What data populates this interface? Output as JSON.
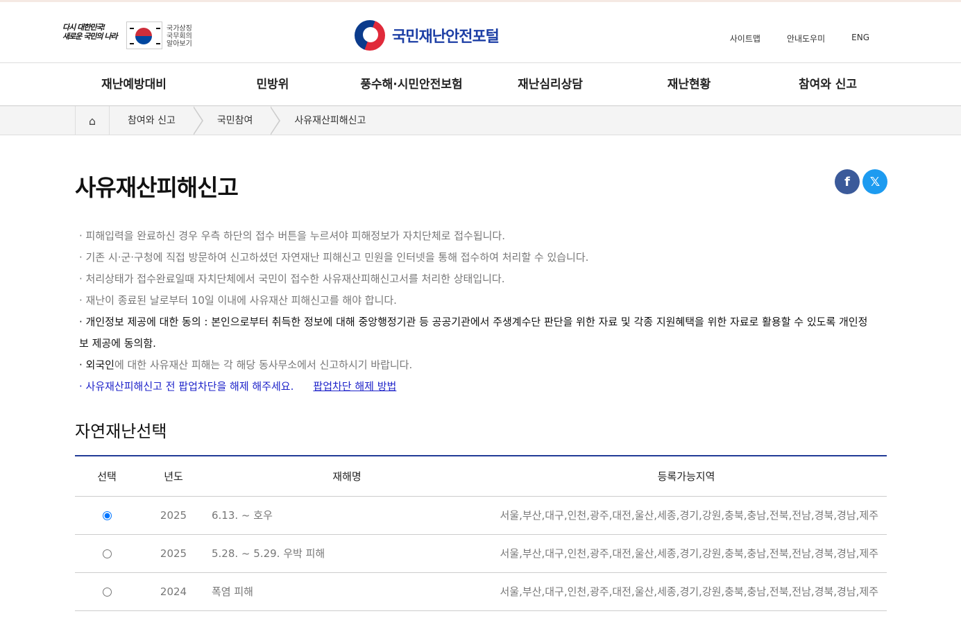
{
  "header": {
    "slogan_line1": "다시 대한민국!",
    "slogan_line2": "새로운 국민의 나라",
    "gov_text": [
      "국가상징",
      "국무회의",
      "알아보기"
    ],
    "logo_text": "국민재난안전포털",
    "util_links": [
      "사이트맵",
      "안내도우미",
      "ENG"
    ]
  },
  "gnb": [
    "재난예방대비",
    "민방위",
    "풍수해·시민안전보험",
    "재난심리상담",
    "재난현황",
    "참여와 신고"
  ],
  "breadcrumb": [
    "참여와 신고",
    "국민참여",
    "사유재산피해신고"
  ],
  "page_title": "사유재산피해신고",
  "sns": {
    "facebook": "f",
    "x": "𝕏"
  },
  "notes": {
    "n1": "· 피해입력을 완료하신 경우 우측 하단의 접수 버튼을 누르셔야 피해정보가 자치단체로 접수됩니다.",
    "n2": "· 기존 시·군·구청에 직접 방문하여 신고하셨던 자연재난 피해신고 민원을 인터넷을 통해 접수하여 처리할 수 있습니다.",
    "n3": "· 처리상태가 접수완료일때 자치단체에서 국민이 접수한 사유재산피해신고서를 처리한 상태입니다.",
    "n4": "· 재난이 종료된 날로부터 10일 이내에 사유재산 피해신고를 해야 합니다.",
    "n5": "· 개인정보 제공에 대한 동의 : 본인으로부터 취득한 정보에 대해 중앙행정기관 등 공공기관에서 주생계수단 판단을 위한 자료 및 각종 지원혜택을 위한 자료로 활용할 수 있도록 개인정보 제공에 동의함.",
    "n6_prefix": "· 외국인",
    "n6_rest": "에 대한 사유재산 피해는 각 해당 동사무소에서 신고하시기 바랍니다.",
    "n7": "· 사유재산피해신고 전 팝업차단을 해제 해주세요.",
    "n7_link": "팝업차단 해제 방법"
  },
  "section_title": "자연재난선택",
  "table": {
    "headers": [
      "선택",
      "년도",
      "재해명",
      "등록가능지역"
    ],
    "rows": [
      {
        "year": "2025",
        "name": "6.13. ~ 호우",
        "region": "서울,부산,대구,인천,광주,대전,울산,세종,경기,강원,충북,충남,전북,전남,경북,경남,제주",
        "checked": true
      },
      {
        "year": "2025",
        "name": "5.28. ~ 5.29. 우박 피해",
        "region": "서울,부산,대구,인천,광주,대전,울산,세종,경기,강원,충북,충남,전북,전남,경북,경남,제주",
        "checked": false
      },
      {
        "year": "2024",
        "name": "폭염 피해",
        "region": "서울,부산,대구,인천,광주,대전,울산,세종,경기,강원,충북,충남,전북,전남,경북,경남,제주",
        "checked": false
      }
    ]
  }
}
